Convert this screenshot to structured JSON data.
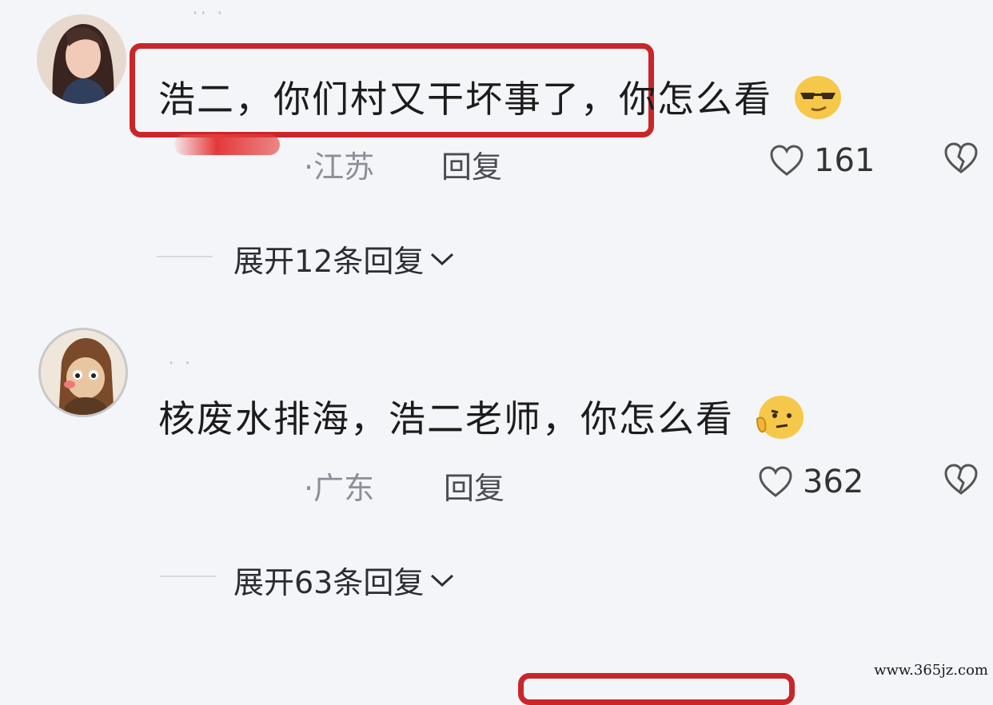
{
  "comments": [
    {
      "username": "·· ·",
      "text": "浩二，你们村又干坏事了，你怎么看",
      "emoji": "sunglasses-face",
      "location": "·江苏",
      "reply_label": "回复",
      "likes": "161",
      "expand_label": "展开12条回复",
      "highlighted": true
    },
    {
      "username": "· ·",
      "text": "核废水排海，浩二老师，你怎么看",
      "emoji": "thinking-face",
      "location": "·广东",
      "reply_label": "回复",
      "likes": "362",
      "expand_label": "展开63条回复",
      "highlighted": false
    }
  ],
  "watermark": "www.365jz.com",
  "colors": {
    "highlight": "#c9262a",
    "background": "#f4f5f8",
    "meta_text": "#8c8f97"
  }
}
